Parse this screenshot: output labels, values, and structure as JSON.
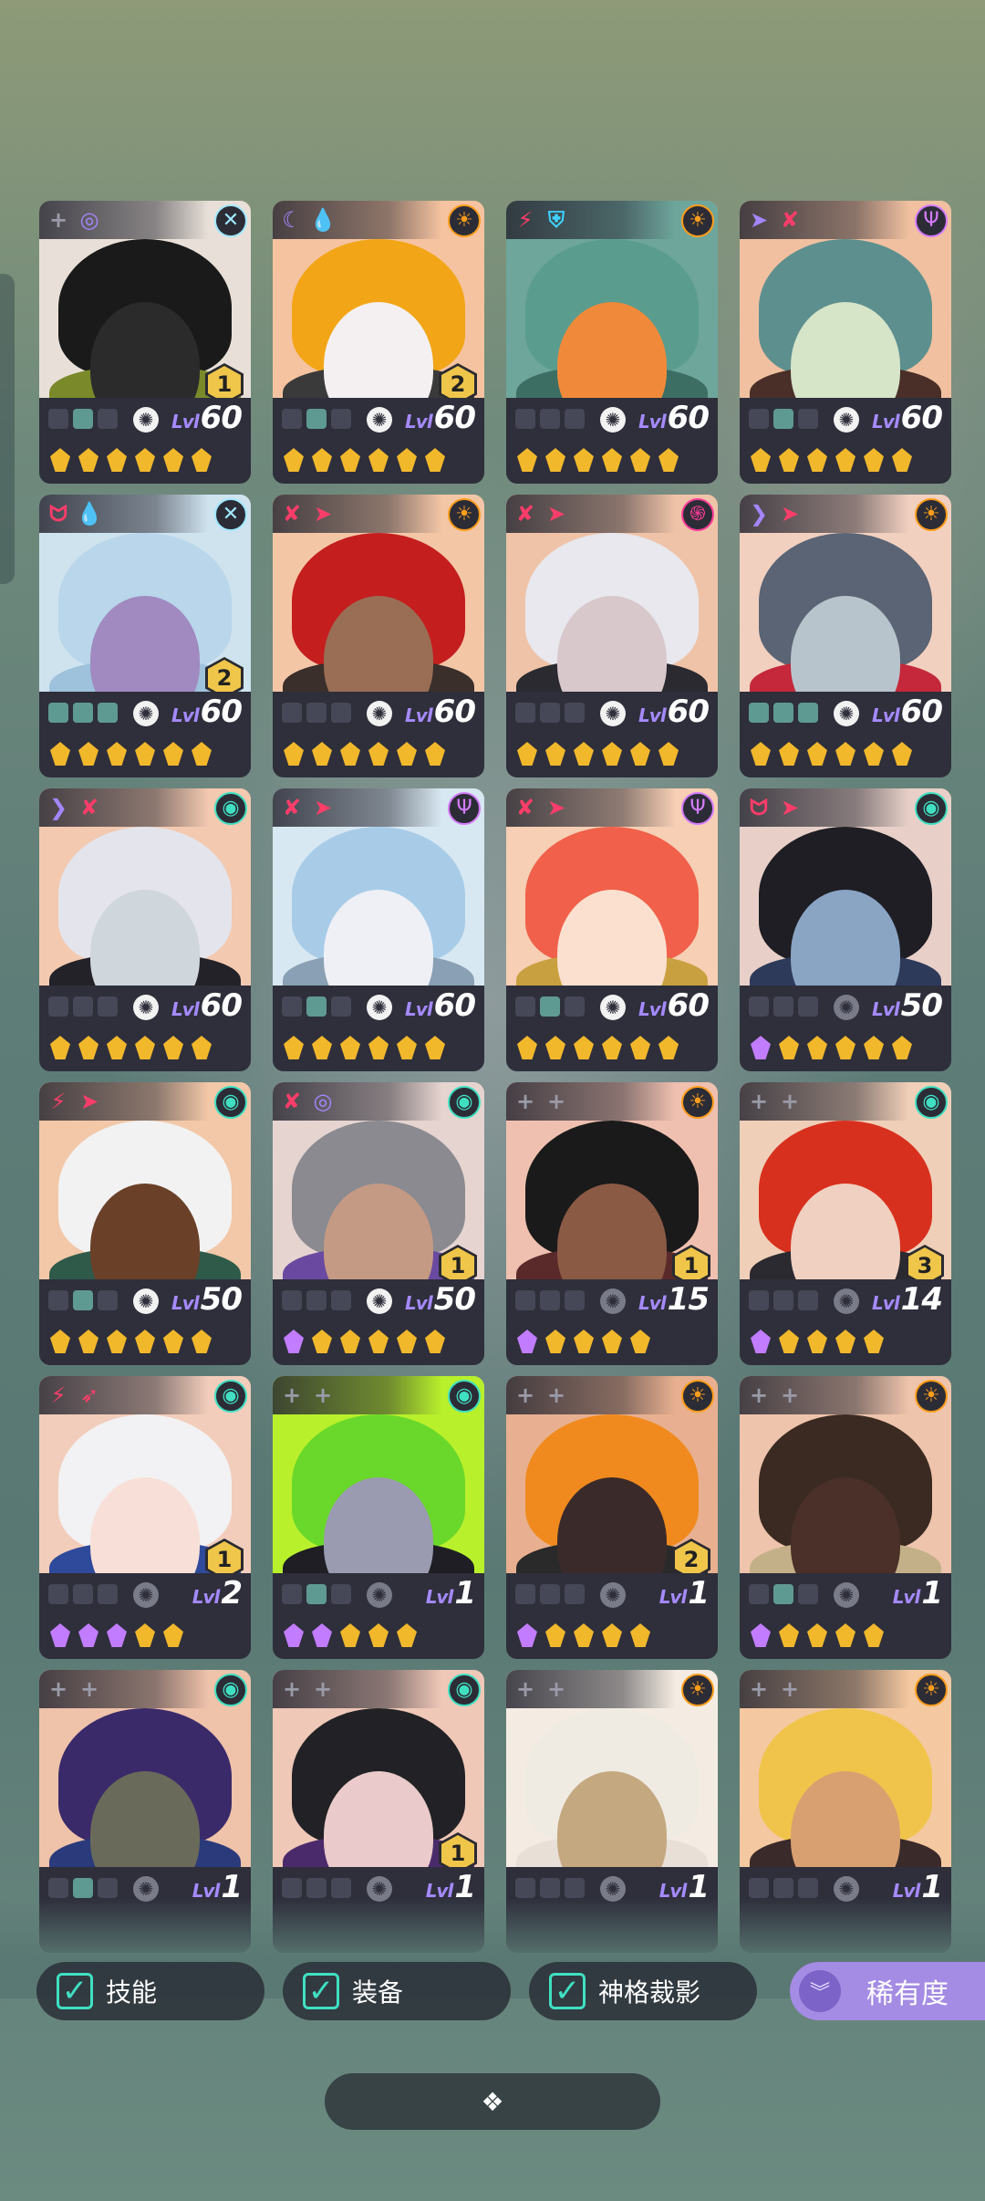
{
  "heroes": [
    {
      "tags": [
        {
          "icon": "plus-icon",
          "glyph": "+",
          "color": "#9a9aa8"
        },
        {
          "icon": "crosshair-icon",
          "glyph": "◎",
          "color": "#a586ff"
        }
      ],
      "faction": {
        "icon": "x-circle-icon",
        "glyph": "✕",
        "color": "#9fe8ff"
      },
      "badge": "1",
      "slots": [
        0,
        1,
        0
      ],
      "awaken_dim": false,
      "lvl_prefix": "Lvl",
      "lvl": "60",
      "stars": [
        "g",
        "g",
        "g",
        "g",
        "g",
        "g"
      ],
      "bg": "#e8e0d8",
      "hair": "#1a1a1a",
      "skin": "#2b2b2b",
      "body": "#7a8a2a"
    },
    {
      "tags": [
        {
          "icon": "moon-icon",
          "glyph": "☾",
          "color": "#a586ff"
        },
        {
          "icon": "drop-icon",
          "glyph": "💧",
          "color": "#3fd2ff"
        }
      ],
      "faction": {
        "icon": "sun-icon",
        "glyph": "☀",
        "color": "#ff9d1a"
      },
      "badge": "2",
      "slots": [
        0,
        1,
        0
      ],
      "awaken_dim": false,
      "lvl_prefix": "Lvl",
      "lvl": "60",
      "stars": [
        "g",
        "g",
        "g",
        "g",
        "g",
        "g"
      ],
      "bg": "#f5c3a0",
      "hair": "#f2a516",
      "skin": "#f4f0f2",
      "body": "#3a3a3a"
    },
    {
      "tags": [
        {
          "icon": "bolt-icon",
          "glyph": "⚡",
          "color": "#ff3d6a"
        },
        {
          "icon": "shield-icon",
          "glyph": "⛨",
          "color": "#3fd2ff"
        }
      ],
      "faction": {
        "icon": "sun-icon",
        "glyph": "☀",
        "color": "#ff9d1a"
      },
      "badge": "",
      "slots": [
        0,
        0,
        0
      ],
      "awaken_dim": false,
      "lvl_prefix": "Lvl",
      "lvl": "60",
      "stars": [
        "g",
        "g",
        "g",
        "g",
        "g",
        "g"
      ],
      "bg": "#6ea69c",
      "hair": "#5a9c8e",
      "skin": "#f08a3a",
      "body": "#3c6e64"
    },
    {
      "tags": [
        {
          "icon": "arrow-icon",
          "glyph": "➤",
          "color": "#a586ff"
        },
        {
          "icon": "sword-icon",
          "glyph": "✘",
          "color": "#ff3d6a"
        }
      ],
      "faction": {
        "icon": "claw-icon",
        "glyph": "Ψ",
        "color": "#d57bff"
      },
      "badge": "",
      "slots": [
        0,
        1,
        0
      ],
      "awaken_dim": false,
      "lvl_prefix": "Lvl",
      "lvl": "60",
      "stars": [
        "g",
        "g",
        "g",
        "g",
        "g",
        "g"
      ],
      "bg": "#f0c0a0",
      "hair": "#5e8f8f",
      "skin": "#d6e4c8",
      "body": "#4a2f28"
    },
    {
      "tags": [
        {
          "icon": "fang-icon",
          "glyph": "ᗢ",
          "color": "#ff3d6a"
        },
        {
          "icon": "drop-icon",
          "glyph": "💧",
          "color": "#3fd2ff"
        }
      ],
      "faction": {
        "icon": "x-circle-icon",
        "glyph": "✕",
        "color": "#9fe8ff"
      },
      "badge": "2",
      "slots": [
        1,
        1,
        1
      ],
      "awaken_dim": false,
      "lvl_prefix": "Lvl",
      "lvl": "60",
      "stars": [
        "g",
        "g",
        "g",
        "g",
        "g",
        "g"
      ],
      "bg": "#cfe3ef",
      "hair": "#b9d6ea",
      "skin": "#a08ac0",
      "body": "#9ec2dc"
    },
    {
      "tags": [
        {
          "icon": "sword-icon",
          "glyph": "✘",
          "color": "#ff3d6a"
        },
        {
          "icon": "arrow-icon",
          "glyph": "➤",
          "color": "#ff3d6a"
        }
      ],
      "faction": {
        "icon": "sun-icon",
        "glyph": "☀",
        "color": "#ff9d1a"
      },
      "badge": "",
      "slots": [
        0,
        0,
        0
      ],
      "awaken_dim": false,
      "lvl_prefix": "Lvl",
      "lvl": "60",
      "stars": [
        "g",
        "g",
        "g",
        "g",
        "g",
        "g"
      ],
      "bg": "#f3c6a6",
      "hair": "#c41e1e",
      "skin": "#9a6e55",
      "body": "#3a2f2a"
    },
    {
      "tags": [
        {
          "icon": "sword-icon",
          "glyph": "✘",
          "color": "#ff3d6a"
        },
        {
          "icon": "arrow-icon",
          "glyph": "➤",
          "color": "#ff3d6a"
        }
      ],
      "faction": {
        "icon": "swirl-icon",
        "glyph": "֍",
        "color": "#ff3d9a"
      },
      "badge": "",
      "slots": [
        0,
        0,
        0
      ],
      "awaken_dim": false,
      "lvl_prefix": "Lvl",
      "lvl": "60",
      "stars": [
        "g",
        "g",
        "g",
        "g",
        "g",
        "g"
      ],
      "bg": "#efc3a8",
      "hair": "#e8e8ee",
      "skin": "#d8c8cc",
      "body": "#2a2a30"
    },
    {
      "tags": [
        {
          "icon": "wing-icon",
          "glyph": "❯",
          "color": "#a586ff"
        },
        {
          "icon": "arrow-icon",
          "glyph": "➤",
          "color": "#ff3d6a"
        }
      ],
      "faction": {
        "icon": "sun-icon",
        "glyph": "☀",
        "color": "#ff9d1a"
      },
      "badge": "",
      "slots": [
        1,
        1,
        1
      ],
      "awaken_dim": false,
      "lvl_prefix": "Lvl",
      "lvl": "60",
      "stars": [
        "g",
        "g",
        "g",
        "g",
        "g",
        "g"
      ],
      "bg": "#f2d0c0",
      "hair": "#5a6474",
      "skin": "#b8c4cc",
      "body": "#c4283a"
    },
    {
      "tags": [
        {
          "icon": "wing-icon",
          "glyph": "❯",
          "color": "#a586ff"
        },
        {
          "icon": "sword-icon",
          "glyph": "✘",
          "color": "#ff3d6a"
        }
      ],
      "faction": {
        "icon": "spiral-icon",
        "glyph": "◉",
        "color": "#3fe0c2"
      },
      "badge": "",
      "slots": [
        0,
        0,
        0
      ],
      "awaken_dim": false,
      "lvl_prefix": "Lvl",
      "lvl": "60",
      "stars": [
        "g",
        "g",
        "g",
        "g",
        "g",
        "g"
      ],
      "bg": "#f3c9b0",
      "hair": "#e4e4ec",
      "skin": "#cfd6dc",
      "body": "#222228"
    },
    {
      "tags": [
        {
          "icon": "sword-icon",
          "glyph": "✘",
          "color": "#ff3d6a"
        },
        {
          "icon": "arrow-icon",
          "glyph": "➤",
          "color": "#ff3d6a"
        }
      ],
      "faction": {
        "icon": "claw-icon",
        "glyph": "Ψ",
        "color": "#d57bff"
      },
      "badge": "",
      "slots": [
        0,
        1,
        0
      ],
      "awaken_dim": false,
      "lvl_prefix": "Lvl",
      "lvl": "60",
      "stars": [
        "g",
        "g",
        "g",
        "g",
        "g",
        "g"
      ],
      "bg": "#d8e8f2",
      "hair": "#a8cce8",
      "skin": "#eef0f6",
      "body": "#8aa0b4"
    },
    {
      "tags": [
        {
          "icon": "sword-icon",
          "glyph": "✘",
          "color": "#ff3d6a"
        },
        {
          "icon": "arrow-icon",
          "glyph": "➤",
          "color": "#ff3d6a"
        }
      ],
      "faction": {
        "icon": "claw-icon",
        "glyph": "Ψ",
        "color": "#d57bff"
      },
      "badge": "",
      "slots": [
        0,
        1,
        0
      ],
      "awaken_dim": false,
      "lvl_prefix": "Lvl",
      "lvl": "60",
      "stars": [
        "g",
        "g",
        "g",
        "g",
        "g",
        "g"
      ],
      "bg": "#f6cfb4",
      "hair": "#f0604a",
      "skin": "#fbe0d0",
      "body": "#c9a040"
    },
    {
      "tags": [
        {
          "icon": "fang-icon",
          "glyph": "ᗢ",
          "color": "#ff3d6a"
        },
        {
          "icon": "arrow-icon",
          "glyph": "➤",
          "color": "#ff3d6a"
        }
      ],
      "faction": {
        "icon": "spiral-icon",
        "glyph": "◉",
        "color": "#3fe0c2"
      },
      "badge": "",
      "slots": [
        0,
        0,
        0
      ],
      "awaken_dim": true,
      "lvl_prefix": "Lvl",
      "lvl": "50",
      "stars": [
        "p",
        "g",
        "g",
        "g",
        "g",
        "g"
      ],
      "bg": "#e8d0c8",
      "hair": "#1e1e24",
      "skin": "#8aa4c4",
      "body": "#2d3a5a"
    },
    {
      "tags": [
        {
          "icon": "bolt-icon",
          "glyph": "⚡",
          "color": "#ff3d6a"
        },
        {
          "icon": "arrow-icon",
          "glyph": "➤",
          "color": "#ff3d6a"
        }
      ],
      "faction": {
        "icon": "spiral-icon",
        "glyph": "◉",
        "color": "#3fe0c2"
      },
      "badge": "",
      "slots": [
        0,
        1,
        0
      ],
      "awaken_dim": false,
      "lvl_prefix": "Lvl",
      "lvl": "50",
      "stars": [
        "g",
        "g",
        "g",
        "g",
        "g",
        "g"
      ],
      "bg": "#f2c8a8",
      "hair": "#f2f2f2",
      "skin": "#6a4028",
      "body": "#2f5a4a"
    },
    {
      "tags": [
        {
          "icon": "sword-icon",
          "glyph": "✘",
          "color": "#ff3d6a"
        },
        {
          "icon": "crosshair-icon",
          "glyph": "◎",
          "color": "#a586ff"
        }
      ],
      "faction": {
        "icon": "spiral-icon",
        "glyph": "◉",
        "color": "#3fe0c2"
      },
      "badge": "1",
      "slots": [
        0,
        0,
        0
      ],
      "awaken_dim": false,
      "lvl_prefix": "Lvl",
      "lvl": "50",
      "stars": [
        "p",
        "g",
        "g",
        "g",
        "g",
        "g"
      ],
      "bg": "#e6d4d0",
      "hair": "#8a8a90",
      "skin": "#c49a84",
      "body": "#6a4aa0"
    },
    {
      "tags": [
        {
          "icon": "plus-icon",
          "glyph": "+",
          "color": "#9a9aa8"
        },
        {
          "icon": "plus-icon",
          "glyph": "+",
          "color": "#9a9aa8"
        }
      ],
      "faction": {
        "icon": "sun-icon",
        "glyph": "☀",
        "color": "#ff9d1a"
      },
      "badge": "1",
      "slots": [
        0,
        0,
        0
      ],
      "awaken_dim": true,
      "lvl_prefix": "Lvl",
      "lvl": "15",
      "stars": [
        "p",
        "g",
        "g",
        "g",
        "g"
      ],
      "bg": "#efc0b0",
      "hair": "#1a1a1a",
      "skin": "#8a5a44",
      "body": "#5a2a2a"
    },
    {
      "tags": [
        {
          "icon": "plus-icon",
          "glyph": "+",
          "color": "#9a9aa8"
        },
        {
          "icon": "plus-icon",
          "glyph": "+",
          "color": "#9a9aa8"
        }
      ],
      "faction": {
        "icon": "spiral-icon",
        "glyph": "◉",
        "color": "#3fe0c2"
      },
      "badge": "3",
      "slots": [
        0,
        0,
        0
      ],
      "awaken_dim": true,
      "lvl_prefix": "Lvl",
      "lvl": "14",
      "stars": [
        "p",
        "g",
        "g",
        "g",
        "g"
      ],
      "bg": "#f0cfb8",
      "hair": "#d8301e",
      "skin": "#f0d0c0",
      "body": "#2a2a30"
    },
    {
      "tags": [
        {
          "icon": "bolt-icon",
          "glyph": "⚡",
          "color": "#ff3d6a"
        },
        {
          "icon": "bird-icon",
          "glyph": "➶",
          "color": "#ff3d6a"
        }
      ],
      "faction": {
        "icon": "spiral-icon",
        "glyph": "◉",
        "color": "#3fe0c2"
      },
      "badge": "1",
      "slots": [
        0,
        0,
        0
      ],
      "awaken_dim": true,
      "lvl_prefix": "Lvl",
      "lvl": "2",
      "stars": [
        "p",
        "p",
        "p",
        "g",
        "g"
      ],
      "bg": "#f2cdbb",
      "hair": "#f2f2f4",
      "skin": "#f8e0d8",
      "body": "#2f4a9a"
    },
    {
      "tags": [
        {
          "icon": "plus-icon",
          "glyph": "+",
          "color": "#9a9aa8"
        },
        {
          "icon": "plus-icon",
          "glyph": "+",
          "color": "#9a9aa8"
        }
      ],
      "faction": {
        "icon": "spiral-icon",
        "glyph": "◉",
        "color": "#3fe0c2"
      },
      "badge": "",
      "slots": [
        0,
        1,
        0
      ],
      "awaken_dim": true,
      "lvl_prefix": "Lvl",
      "lvl": "1",
      "stars": [
        "p",
        "p",
        "g",
        "g",
        "g"
      ],
      "bg": "#b8f02c",
      "hair": "#6ad82a",
      "skin": "#9a9ab0",
      "body": "#1e1e24"
    },
    {
      "tags": [
        {
          "icon": "plus-icon",
          "glyph": "+",
          "color": "#9a9aa8"
        },
        {
          "icon": "plus-icon",
          "glyph": "+",
          "color": "#9a9aa8"
        }
      ],
      "faction": {
        "icon": "sun-icon",
        "glyph": "☀",
        "color": "#ff9d1a"
      },
      "badge": "2",
      "slots": [
        0,
        0,
        0
      ],
      "awaken_dim": true,
      "lvl_prefix": "Lvl",
      "lvl": "1",
      "stars": [
        "p",
        "g",
        "g",
        "g",
        "g"
      ],
      "bg": "#e8b090",
      "hair": "#f08a1e",
      "skin": "#3a2a2a",
      "body": "#2a2a2a"
    },
    {
      "tags": [
        {
          "icon": "plus-icon",
          "glyph": "+",
          "color": "#9a9aa8"
        },
        {
          "icon": "plus-icon",
          "glyph": "+",
          "color": "#9a9aa8"
        }
      ],
      "faction": {
        "icon": "sun-icon",
        "glyph": "☀",
        "color": "#ff9d1a"
      },
      "badge": "",
      "slots": [
        0,
        1,
        0
      ],
      "awaken_dim": true,
      "lvl_prefix": "Lvl",
      "lvl": "1",
      "stars": [
        "p",
        "g",
        "g",
        "g",
        "g"
      ],
      "bg": "#efc4ac",
      "hair": "#3a2a22",
      "skin": "#4a3028",
      "body": "#c4b088"
    },
    {
      "tags": [
        {
          "icon": "plus-icon",
          "glyph": "+",
          "color": "#9a9aa8"
        },
        {
          "icon": "plus-icon",
          "glyph": "+",
          "color": "#9a9aa8"
        }
      ],
      "faction": {
        "icon": "spiral-icon",
        "glyph": "◉",
        "color": "#3fe0c2"
      },
      "badge": "",
      "slots": [
        0,
        1,
        0
      ],
      "awaken_dim": true,
      "lvl_prefix": "Lvl",
      "lvl": "1",
      "stars": [],
      "bg": "#efc2aa",
      "hair": "#3a2a6a",
      "skin": "#6a6a5a",
      "body": "#2a3a7a"
    },
    {
      "tags": [
        {
          "icon": "plus-icon",
          "glyph": "+",
          "color": "#9a9aa8"
        },
        {
          "icon": "plus-icon",
          "glyph": "+",
          "color": "#9a9aa8"
        }
      ],
      "faction": {
        "icon": "spiral-icon",
        "glyph": "◉",
        "color": "#3fe0c2"
      },
      "badge": "1",
      "slots": [
        0,
        0,
        0
      ],
      "awaken_dim": true,
      "lvl_prefix": "Lvl",
      "lvl": "1",
      "stars": [],
      "bg": "#f0c8b8",
      "hair": "#222226",
      "skin": "#eacaca",
      "body": "#4a2a6a"
    },
    {
      "tags": [
        {
          "icon": "plus-icon",
          "glyph": "+",
          "color": "#9a9aa8"
        },
        {
          "icon": "plus-icon",
          "glyph": "+",
          "color": "#9a9aa8"
        }
      ],
      "faction": {
        "icon": "sun-icon",
        "glyph": "☀",
        "color": "#ff9d1a"
      },
      "badge": "",
      "slots": [
        0,
        0,
        0
      ],
      "awaken_dim": true,
      "lvl_prefix": "Lvl",
      "lvl": "1",
      "stars": [],
      "bg": "#f4ece2",
      "hair": "#f0ebe2",
      "skin": "#c4a880",
      "body": "#e8e0d6"
    },
    {
      "tags": [
        {
          "icon": "plus-icon",
          "glyph": "+",
          "color": "#9a9aa8"
        },
        {
          "icon": "plus-icon",
          "glyph": "+",
          "color": "#9a9aa8"
        }
      ],
      "faction": {
        "icon": "sun-icon",
        "glyph": "☀",
        "color": "#ff9d1a"
      },
      "badge": "",
      "slots": [
        0,
        0,
        0
      ],
      "awaken_dim": true,
      "lvl_prefix": "Lvl",
      "lvl": "1",
      "stars": [],
      "bg": "#f4c8a0",
      "hair": "#f0c44a",
      "skin": "#d8a070",
      "body": "#3a2a2a"
    }
  ],
  "filters": [
    {
      "label": "技能",
      "checked": true
    },
    {
      "label": "装备",
      "checked": true
    },
    {
      "label": "神格裁影",
      "checked": true
    }
  ],
  "rarity_button": {
    "label": "稀有度",
    "icon": "double-chevron-down-icon"
  },
  "handle": {
    "icon": "diamond-cluster-icon",
    "glyph": "❖"
  },
  "colors": {
    "accent_teal": "#3fe0c2",
    "rarity_purple": "#a48be4",
    "star_gold": "#f2b82c",
    "star_purple": "#c27cff"
  }
}
